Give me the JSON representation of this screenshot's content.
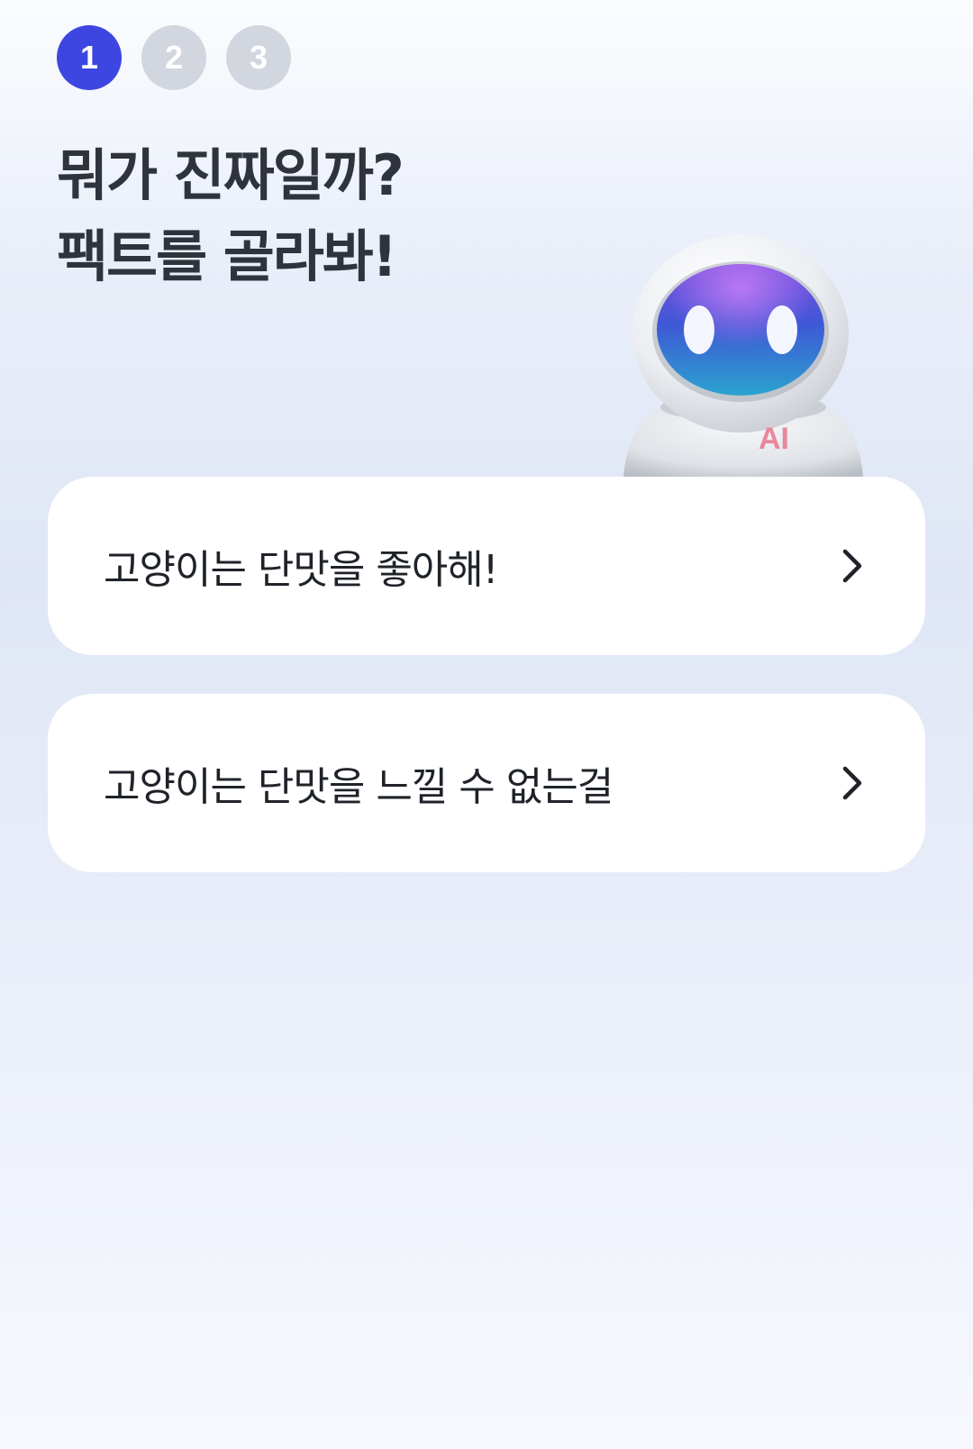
{
  "steps": [
    {
      "label": "1",
      "state": "active"
    },
    {
      "label": "2",
      "state": "inactive"
    },
    {
      "label": "3",
      "state": "inactive"
    }
  ],
  "heading": {
    "line1": "뭐가 진짜일까?",
    "line2": "팩트를 골라봐!"
  },
  "robot": {
    "badge_text": "AI",
    "icon": "robot-mascot-icon"
  },
  "options": [
    {
      "label": "고양이는 단맛을 좋아해!",
      "icon": "chevron-right-icon"
    },
    {
      "label": "고양이는 단맛을 느낄 수 없는걸",
      "icon": "chevron-right-icon"
    }
  ],
  "colors": {
    "accent": "#3d46e0",
    "inactive_step": "#d2d6de",
    "heading_text": "#2f343c",
    "card_background": "#ffffff",
    "robot_badge": "#e9879b"
  }
}
